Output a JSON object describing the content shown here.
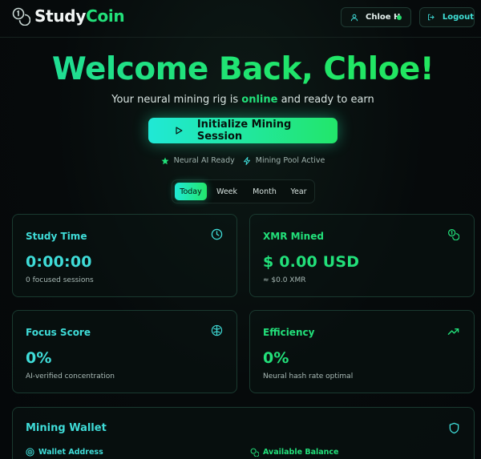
{
  "header": {
    "brand_part1": "Study",
    "brand_part2": "Coin",
    "user_name": "Chloe H",
    "logout_label": "Logout"
  },
  "hero": {
    "title": "Welcome Back, Chloe!",
    "subtitle_before": "Your neural mining rig is ",
    "subtitle_status": "online",
    "subtitle_after": " and ready to earn",
    "start_button": "Initialize Mining Session"
  },
  "status_badges": [
    {
      "label": "Neural AI Ready",
      "icon": "star-icon"
    },
    {
      "label": "Mining Pool Active",
      "icon": "lightning-icon"
    }
  ],
  "range_tabs": {
    "items": [
      "Today",
      "Week",
      "Month",
      "Year"
    ],
    "active": "Today"
  },
  "stats": {
    "study_time": {
      "title": "Study Time",
      "value": "0:00:00",
      "sub": "0 focused sessions",
      "icon": "clock-icon"
    },
    "xmr_mined": {
      "title": "XMR Mined",
      "value": "$ 0.00 USD",
      "sub": "≈ $0.0 XMR",
      "icon": "coins-icon"
    },
    "focus_score": {
      "title": "Focus Score",
      "value": "0%",
      "sub": "AI-verified concentration",
      "icon": "brain-icon"
    },
    "efficiency": {
      "title": "Efficiency",
      "value": "0%",
      "sub": "Neural hash rate optimal",
      "icon": "trending-up-icon"
    }
  },
  "wallet": {
    "title": "Mining Wallet",
    "address_label": "Wallet Address",
    "balance_label": "Available Balance",
    "icon": "shield-icon"
  },
  "colors": {
    "accent_teal": "#3fdcd8",
    "accent_green": "#22e07a",
    "background": "#060a0b"
  }
}
